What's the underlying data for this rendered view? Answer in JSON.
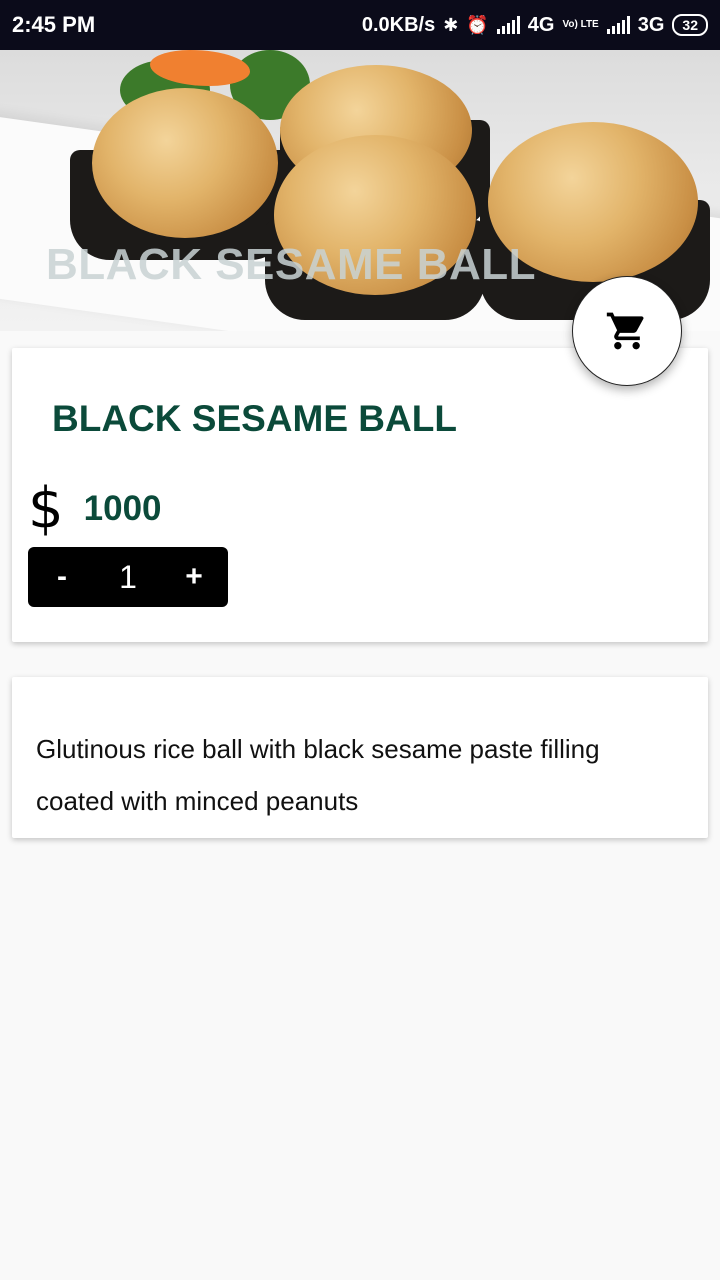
{
  "status_bar": {
    "time": "2:45 PM",
    "net_speed": "0.0KB/s",
    "network1": "4G",
    "volte": "Vo) LTE",
    "network2": "3G",
    "battery": "32"
  },
  "hero": {
    "title_overlay": "BLACK SESAME BALL"
  },
  "cart_button": {
    "icon": "cart-icon"
  },
  "product": {
    "name": "BLACK SESAME BALL",
    "currency_symbol": "$",
    "price": "1000",
    "quantity": "1",
    "decrement_label": "-",
    "increment_label": "+"
  },
  "description": {
    "text": "Glutinous rice ball with black sesame paste filling coated with minced peanuts"
  },
  "colors": {
    "accent": "#0b4a3a",
    "status_bar": "#0b0b1a",
    "stepper_bg": "#000000"
  }
}
